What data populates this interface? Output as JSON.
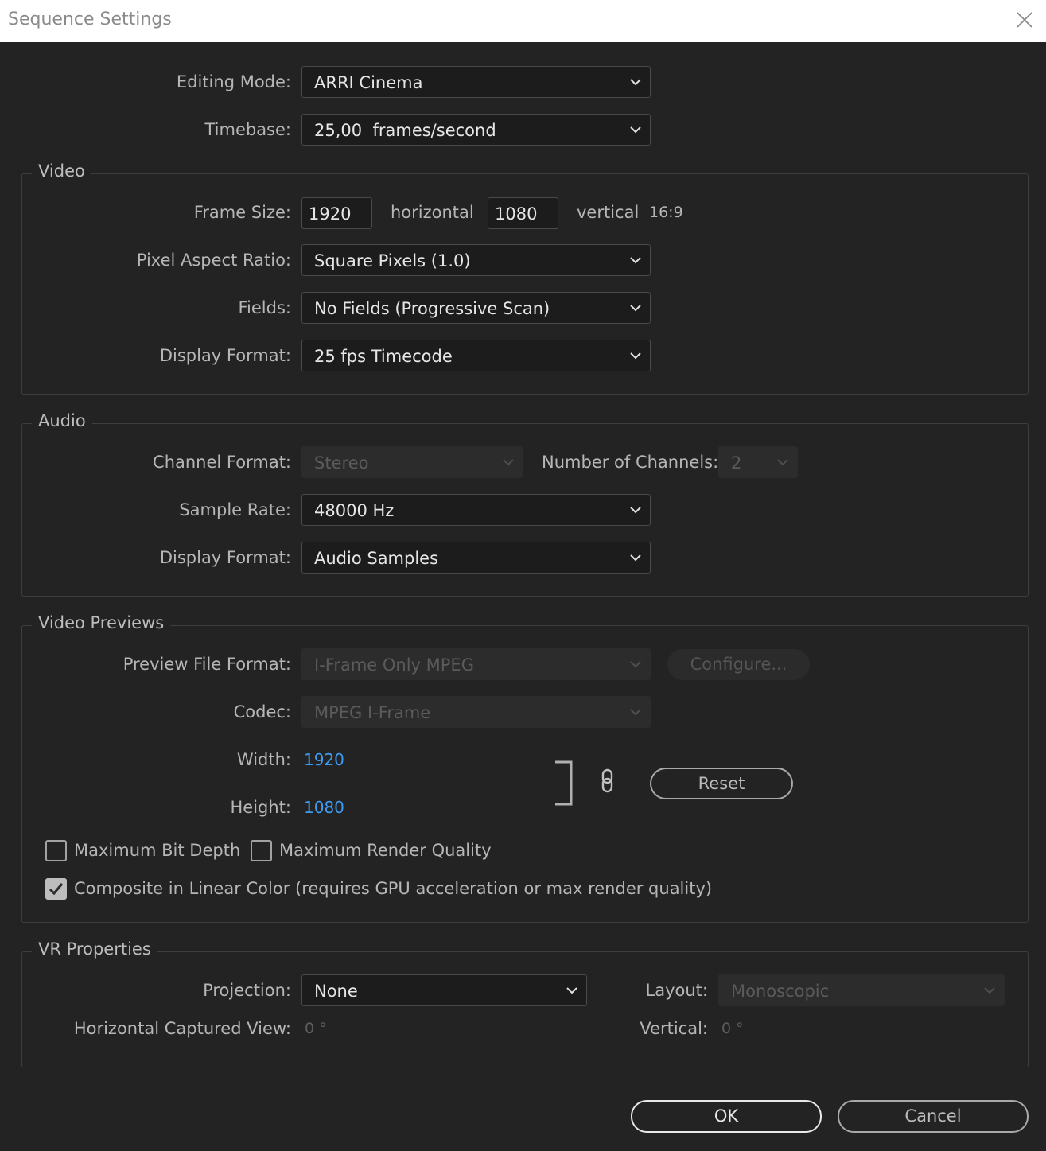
{
  "window": {
    "title": "Sequence Settings",
    "close_icon": "close-icon"
  },
  "general": {
    "editing_mode_label": "Editing Mode:",
    "editing_mode_value": "ARRI Cinema",
    "timebase_label": "Timebase:",
    "timebase_value": "25,00  frames/second"
  },
  "video": {
    "group_title": "Video",
    "frame_size_label": "Frame Size:",
    "frame_width": "1920",
    "horizontal_label": "horizontal",
    "frame_height": "1080",
    "vertical_label": "vertical",
    "aspect": "16:9",
    "pixel_aspect_label": "Pixel Aspect Ratio:",
    "pixel_aspect_value": "Square Pixels (1.0)",
    "fields_label": "Fields:",
    "fields_value": "No Fields (Progressive Scan)",
    "display_format_label": "Display Format:",
    "display_format_value": "25 fps Timecode"
  },
  "audio": {
    "group_title": "Audio",
    "channel_format_label": "Channel Format:",
    "channel_format_value": "Stereo",
    "num_channels_label": "Number of Channels:",
    "num_channels_value": "2",
    "sample_rate_label": "Sample Rate:",
    "sample_rate_value": "48000 Hz",
    "display_format_label": "Display Format:",
    "display_format_value": "Audio Samples"
  },
  "previews": {
    "group_title": "Video Previews",
    "file_format_label": "Preview File Format:",
    "file_format_value": "I-Frame Only MPEG",
    "configure_label": "Configure...",
    "codec_label": "Codec:",
    "codec_value": "MPEG I-Frame",
    "width_label": "Width:",
    "width_value": "1920",
    "height_label": "Height:",
    "height_value": "1080",
    "reset_label": "Reset",
    "max_bit_depth_label": "Maximum Bit Depth",
    "max_bit_depth_checked": false,
    "max_render_quality_label": "Maximum Render Quality",
    "max_render_quality_checked": false,
    "linear_color_label": "Composite in Linear Color (requires GPU acceleration or max render quality)",
    "linear_color_checked": true
  },
  "vr": {
    "group_title": "VR Properties",
    "projection_label": "Projection:",
    "projection_value": "None",
    "layout_label": "Layout:",
    "layout_value": "Monoscopic",
    "h_captured_label": "Horizontal Captured View:",
    "h_captured_value": "0 °",
    "vertical_label": "Vertical:",
    "vertical_value": "0 °"
  },
  "footer": {
    "ok_label": "OK",
    "cancel_label": "Cancel"
  },
  "colors": {
    "background": "#232323",
    "accent_blue": "#3f9bf2",
    "titlebar": "#ffffff"
  }
}
